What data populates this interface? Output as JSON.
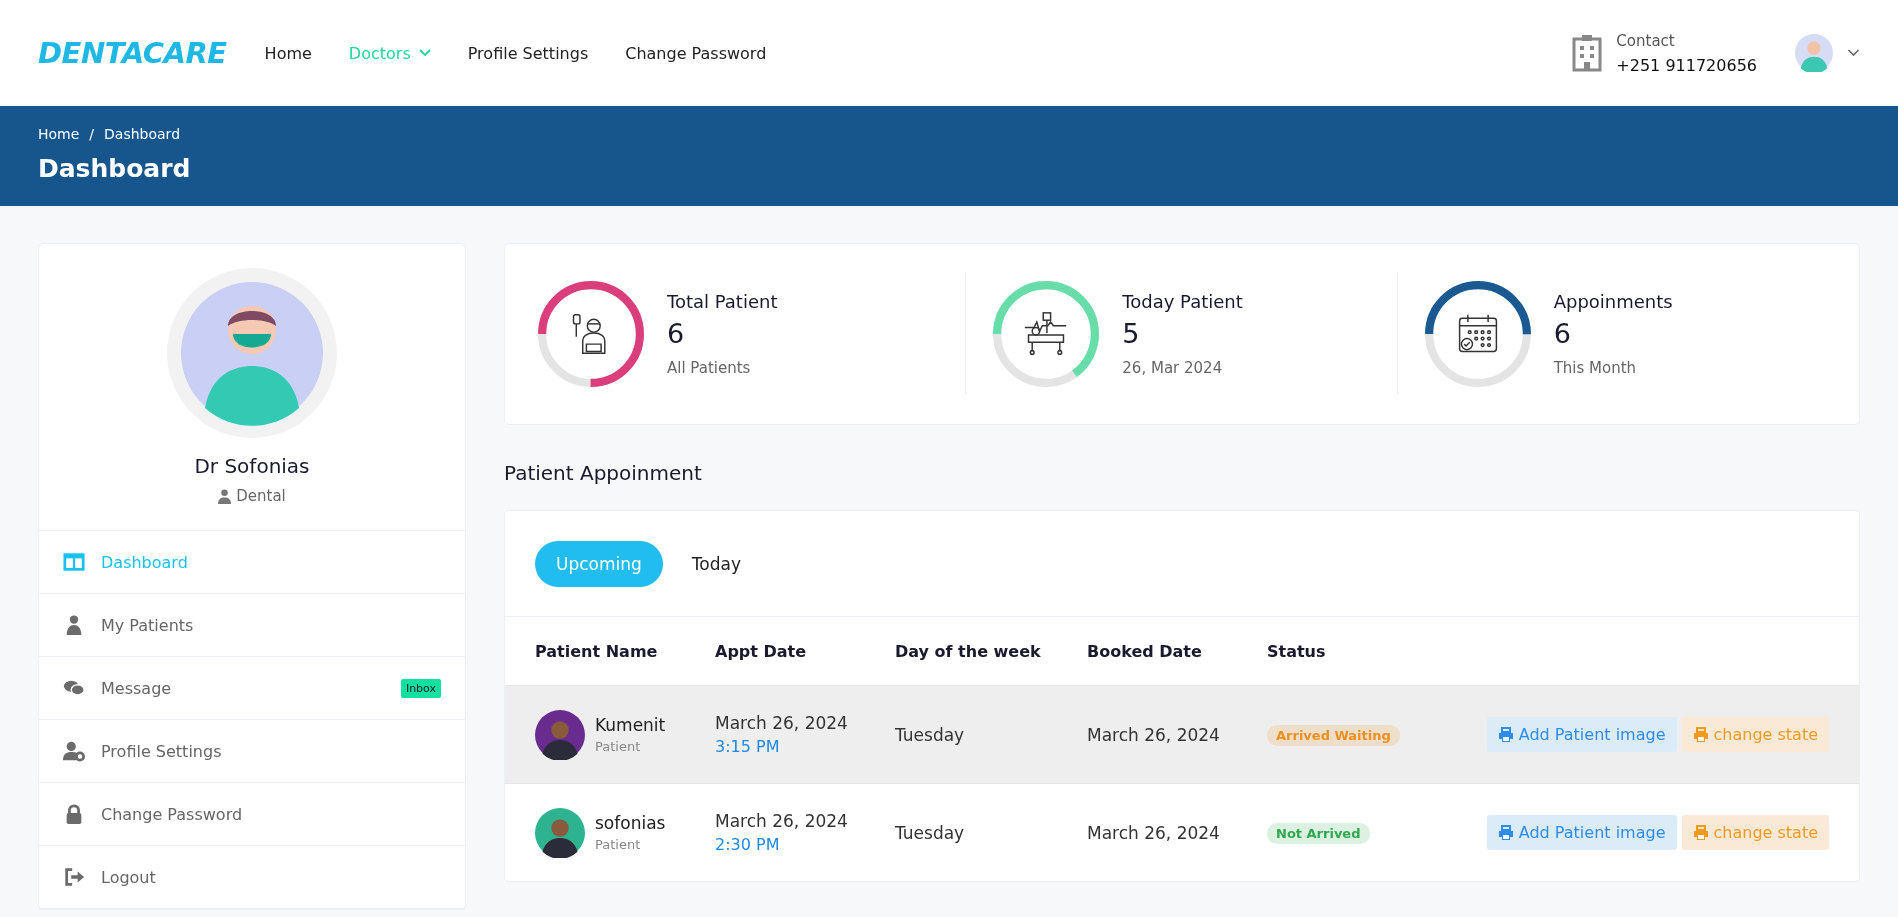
{
  "header": {
    "logo": "DENTACARE",
    "nav": [
      {
        "label": "Home",
        "selected": false,
        "dropdown": false
      },
      {
        "label": "Doctors",
        "selected": true,
        "dropdown": true
      },
      {
        "label": "Profile Settings",
        "selected": false,
        "dropdown": false
      },
      {
        "label": "Change Password",
        "selected": false,
        "dropdown": false
      }
    ],
    "contact": {
      "label": "Contact",
      "phone": "+251 911720656"
    }
  },
  "banner": {
    "breadcrumb": [
      "Home",
      "Dashboard"
    ],
    "separator": "/",
    "title": "Dashboard"
  },
  "sidebar": {
    "name": "Dr Sofonias",
    "specialty": "Dental",
    "items": [
      {
        "label": "Dashboard",
        "selected": true
      },
      {
        "label": "My Patients",
        "selected": false
      },
      {
        "label": "Message",
        "selected": false,
        "badge": "Inbox"
      },
      {
        "label": "Profile Settings",
        "selected": false
      },
      {
        "label": "Change Password",
        "selected": false
      },
      {
        "label": "Logout",
        "selected": false
      }
    ]
  },
  "stats": [
    {
      "title": "Total Patient",
      "value": "6",
      "sub": "All Patients",
      "color": "#da3f7b",
      "level": 0.75
    },
    {
      "title": "Today Patient",
      "value": "5",
      "sub": "26, Mar 2024",
      "color": "#68dda9",
      "level": 0.65
    },
    {
      "title": "Appoinments",
      "value": "6",
      "sub": "This Month",
      "color": "#1b5a90",
      "level": 0.5
    }
  ],
  "appointments": {
    "title": "Patient Appoinment",
    "tabs": [
      {
        "label": "Upcoming",
        "selected": true
      },
      {
        "label": "Today",
        "selected": false
      }
    ],
    "columns": [
      "Patient Name",
      "Appt Date",
      "Day of the week",
      "Booked Date",
      "Status"
    ],
    "rows": [
      {
        "name": "Kumenit",
        "role": "Patient",
        "date": "March 26, 2024",
        "time": "3:15 PM",
        "day": "Tuesday",
        "booked": "March 26, 2024",
        "status": "Arrived Waiting",
        "color": "#f0901a",
        "selected": true,
        "actions": [
          "Add Patient image",
          "change state"
        ]
      },
      {
        "name": "sofonias",
        "role": "Patient",
        "date": "March 26, 2024",
        "time": "2:30 PM",
        "day": "Tuesday",
        "booked": "March 26, 2024",
        "status": "Not Arrived",
        "color": "#2fa84f",
        "selected": false,
        "actions": [
          "Add Patient image",
          "change state"
        ]
      }
    ]
  }
}
